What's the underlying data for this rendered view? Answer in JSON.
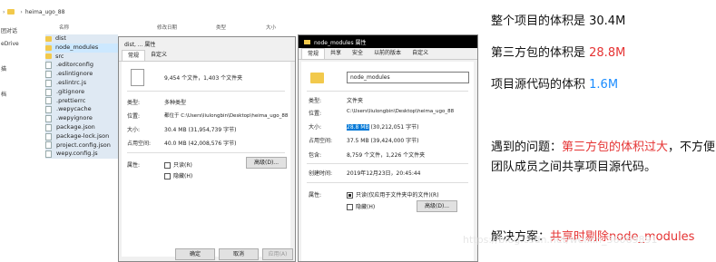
{
  "explorer": {
    "breadcrumb": [
      "heima_ugo_88"
    ],
    "left_nav": [
      "团对话",
      "eDrive",
      "",
      "描",
      "",
      "档"
    ],
    "columns": [
      "名称",
      "修改日期",
      "类型",
      "大小"
    ],
    "files": [
      {
        "name": "dist",
        "kind": "folder"
      },
      {
        "name": "node_modules",
        "kind": "folder"
      },
      {
        "name": "src",
        "kind": "folder"
      },
      {
        "name": ".editorconfig",
        "kind": "doc"
      },
      {
        "name": ".eslintignore",
        "kind": "doc"
      },
      {
        "name": ".eslintrc.js",
        "kind": "doc"
      },
      {
        "name": ".gitignore",
        "kind": "doc"
      },
      {
        "name": ".prettierrc",
        "kind": "doc"
      },
      {
        "name": ".wepycache",
        "kind": "doc"
      },
      {
        "name": ".wepyignore",
        "kind": "doc"
      },
      {
        "name": "package.json",
        "kind": "doc"
      },
      {
        "name": "package-lock.json",
        "kind": "doc"
      },
      {
        "name": "project.config.json",
        "kind": "doc"
      },
      {
        "name": "wepy.config.js",
        "kind": "doc"
      }
    ]
  },
  "dialog1": {
    "title": "dist, ... 属性",
    "tabs": [
      "常规",
      "自定义"
    ],
    "summary": "9,454 个文件，1,403 个文件夹",
    "type_label": "类型:",
    "type_value": "多种类型",
    "loc_label": "位置:",
    "loc_value": "都位于 C:\\Users\\liulongbin\\Desktop\\heima_ugo_88",
    "size_label": "大小:",
    "size_value": "30.4 MB (31,954,739 字节)",
    "disk_label": "占用空间:",
    "disk_value": "40.0 MB (42,008,576 字节)",
    "attr_label": "属性:",
    "readonly": "只读(R)",
    "hidden": "隐藏(H)",
    "advanced_btn": "高级(D)...",
    "ok": "确定",
    "cancel": "取消",
    "apply": "应用(A)"
  },
  "dialog2": {
    "title": "node_modules 属性",
    "tabs": [
      "常规",
      "共享",
      "安全",
      "以前的版本",
      "自定义"
    ],
    "name": "node_modules",
    "type_label": "类型:",
    "type_value": "文件夹",
    "loc_label": "位置:",
    "loc_value": "C:\\Users\\liulongbin\\Desktop\\heima_ugo_88",
    "size_label": "大小:",
    "size_hl": "28.8 MB",
    "size_rest": " (30,212,051 字节)",
    "disk_label": "占用空间:",
    "disk_value": "37.5 MB (39,424,000 字节)",
    "contains_label": "包含:",
    "contains_value": "8,759 个文件，1,226 个文件夹",
    "created_label": "创建时间:",
    "created_value": "2019年12月23日，20:45:44",
    "attr_label": "属性:",
    "readonly": "只读(仅应用于文件夹中的文件)(R)",
    "hidden": "隐藏(H)",
    "advanced_btn": "高级(D)..."
  },
  "notes": {
    "line1_text": "整个项目的体积是 30.4M",
    "line2_prefix": "第三方包的体积是 ",
    "line2_value": "28.8M",
    "line3_prefix": "项目源代码的体积 ",
    "line3_value": "1.6M",
    "problem_prefix": "遇到的问题：",
    "problem_red": "第三方包的体积过大",
    "problem_rest": "，不方便团队成员之间共享项目源代码。",
    "solution_prefix": "解决方案：",
    "solution_red": "共享时剔除node_modules",
    "watermark": "https://blog.csdn.net/weixin_36069891"
  },
  "colors": {
    "red": "#e53333",
    "blue": "#1a8cff",
    "highlight": "#0078d7"
  }
}
